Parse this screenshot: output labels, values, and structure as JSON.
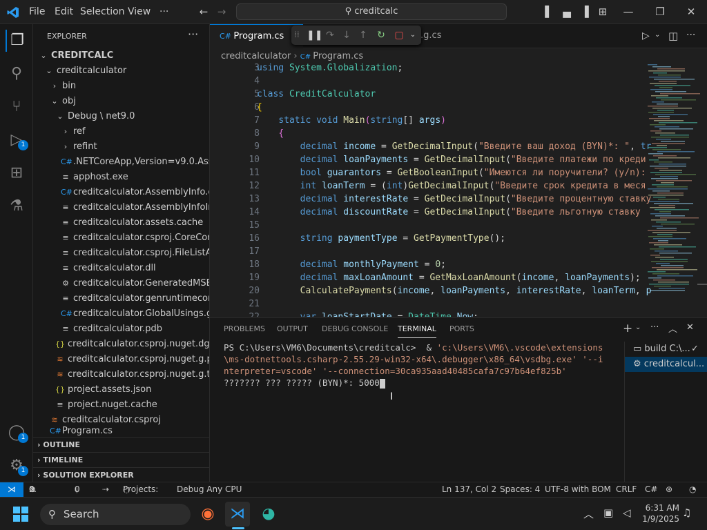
{
  "titlebar": {
    "menus": [
      "File",
      "Edit",
      "Selection",
      "View",
      "···"
    ],
    "search": "creditcalc"
  },
  "activity": {
    "badges": [
      "1",
      "1",
      "1"
    ]
  },
  "explorer": {
    "header": "EXPLORER",
    "more": "···",
    "tree": [
      {
        "label": "CREDITCALC",
        "icon": "chevron-down",
        "indent": 0,
        "bold": true
      },
      {
        "label": "creditcalculator",
        "icon": "chevron-down",
        "indent": 1
      },
      {
        "label": "bin",
        "icon": "chevron-right",
        "indent": 2
      },
      {
        "label": "obj",
        "icon": "chevron-down",
        "indent": 2
      },
      {
        "label": "Debug \\ net9.0",
        "icon": "chevron-down",
        "indent": 3
      },
      {
        "label": "ref",
        "icon": "chevron-right",
        "indent": 4
      },
      {
        "label": "refint",
        "icon": "chevron-right",
        "indent": 4
      },
      {
        "label": ".NETCoreApp,Version=v9.0.Asse...",
        "icon": "csharp",
        "indent": 4
      },
      {
        "label": "apphost.exe",
        "icon": "file",
        "indent": 4
      },
      {
        "label": "creditcalculator.AssemblyInfo.cs",
        "icon": "csharp",
        "indent": 4
      },
      {
        "label": "creditcalculator.AssemblyInfoInp...",
        "icon": "file",
        "indent": 4
      },
      {
        "label": "creditcalculator.assets.cache",
        "icon": "file",
        "indent": 4
      },
      {
        "label": "creditcalculator.csproj.CoreCom...",
        "icon": "file",
        "indent": 4
      },
      {
        "label": "creditcalculator.csproj.FileListAb...",
        "icon": "file",
        "indent": 4
      },
      {
        "label": "creditcalculator.dll",
        "icon": "file",
        "indent": 4
      },
      {
        "label": "creditcalculator.GeneratedMSBui...",
        "icon": "gear",
        "indent": 4
      },
      {
        "label": "creditcalculator.genruntimeconfi...",
        "icon": "file",
        "indent": 4
      },
      {
        "label": "creditcalculator.GlobalUsings.g.cs",
        "icon": "csharp",
        "indent": 4
      },
      {
        "label": "creditcalculator.pdb",
        "icon": "file",
        "indent": 4
      },
      {
        "label": "creditcalculator.csproj.nuget.dgsp...",
        "icon": "json",
        "indent": 3
      },
      {
        "label": "creditcalculator.csproj.nuget.g.pro...",
        "icon": "rss",
        "indent": 3
      },
      {
        "label": "creditcalculator.csproj.nuget.g.tar...",
        "icon": "rss",
        "indent": 3
      },
      {
        "label": "project.assets.json",
        "icon": "json",
        "indent": 3
      },
      {
        "label": "project.nuget.cache",
        "icon": "file",
        "indent": 3
      },
      {
        "label": "creditcalculator.csproj",
        "icon": "rss",
        "indent": 2
      },
      {
        "label": "Program.cs",
        "icon": "csharp",
        "indent": 2
      }
    ],
    "sections": [
      "OUTLINE",
      "TIMELINE",
      "SOLUTION EXPLORER"
    ]
  },
  "editor": {
    "tab_active": "Program.cs",
    "tab_other": "gs.g.cs",
    "breadcrumb": [
      "creditcalculator",
      "Program.cs"
    ],
    "lines": [
      {
        "n": "3",
        "html": "<span class='kw'>using</span> <span class='ty'>System.Globalization</span>;"
      },
      {
        "n": "4",
        "html": ""
      },
      {
        "n": "5",
        "html": "<span class='kw'>class</span> <span class='ty'>CreditCalculator</span>"
      },
      {
        "n": "6",
        "html": "<span class='br'>{</span>"
      },
      {
        "n": "7",
        "html": "    <span class='kw'>static</span> <span class='kw'>void</span> <span class='fn'>Main</span><span class='pu'>(</span><span class='kw'>string</span>[] <span class='vr'>args</span><span class='pu'>)</span>"
      },
      {
        "n": "8",
        "html": "    <span class='pu'>{</span>"
      },
      {
        "n": "9",
        "html": "        <span class='kw'>decimal</span> <span class='vr'>income</span> = <span class='fn'>GetDecimalInput</span>(<span class='st'>\"Введите ваш доход (BYN)*: \"</span>, <span class='kw'>tr</span>"
      },
      {
        "n": "10",
        "html": "        <span class='kw'>decimal</span> <span class='vr'>loanPayments</span> = <span class='fn'>GetDecimalInput</span>(<span class='st'>\"Введите платежи по креди</span>"
      },
      {
        "n": "11",
        "html": "        <span class='kw'>bool</span> <span class='vr'>guarantors</span> = <span class='fn'>GetBooleanInput</span>(<span class='st'>\"Имеются ли поручители? (y/n):</span>"
      },
      {
        "n": "12",
        "html": "        <span class='kw'>int</span> <span class='vr'>loanTerm</span> = (<span class='kw'>int</span>)<span class='fn'>GetDecimalInput</span>(<span class='st'>\"Введите срок кредита в меся</span>"
      },
      {
        "n": "13",
        "html": "        <span class='kw'>decimal</span> <span class='vr'>interestRate</span> = <span class='fn'>GetDecimalInput</span>(<span class='st'>\"Введите процентную ставку</span>"
      },
      {
        "n": "14",
        "html": "        <span class='kw'>decimal</span> <span class='vr'>discountRate</span> = <span class='fn'>GetDecimalInput</span>(<span class='st'>\"Введите льготную ставку</span>"
      },
      {
        "n": "15",
        "html": ""
      },
      {
        "n": "16",
        "html": "        <span class='kw'>string</span> <span class='vr'>paymentType</span> = <span class='fn'>GetPaymentType</span>();"
      },
      {
        "n": "17",
        "html": ""
      },
      {
        "n": "18",
        "html": "        <span class='kw'>decimal</span> <span class='vr'>monthlyPayment</span> = <span class='nm'>0</span>;"
      },
      {
        "n": "19",
        "html": "        <span class='kw'>decimal</span> <span class='vr'>maxLoanAmount</span> = <span class='fn'>GetMaxLoanAmount</span>(<span class='vr'>income</span>, <span class='vr'>loanPayments</span>);"
      },
      {
        "n": "20",
        "html": "        <span class='fn'>CalculatePayments</span>(<span class='vr'>income</span>, <span class='vr'>loanPayments</span>, <span class='vr'>interestRate</span>, <span class='vr'>loanTerm</span>, <span class='vr'>p</span>"
      },
      {
        "n": "21",
        "html": ""
      },
      {
        "n": "22",
        "html": "        <span class='kw'>var</span> <span class='vr'>loanStartDate</span> = <span class='ty'>DateTime</span>.<span class='vr'>Now</span>;"
      }
    ]
  },
  "panel": {
    "tabs": [
      "PROBLEMS",
      "OUTPUT",
      "DEBUG CONSOLE",
      "TERMINAL",
      "PORTS"
    ],
    "active_tab": "TERMINAL",
    "terminal_lines": [
      "PS C:\\Users\\VM6\\Documents\\creditcalc>  & 'c:\\Users\\VM6\\.vscode\\extensions",
      "\\ms-dotnettools.csharp-2.55.29-win32-x64\\.debugger\\x86_64\\vsdbg.exe' '--i",
      "nterpreter=vscode' '--connection=30ca935aad40485cafa7c97b64ef825b'",
      "??????? ??? ????? (BYN)*: 5000"
    ],
    "terminals": [
      "build C:\\...",
      "creditcalcul..."
    ]
  },
  "statusbar": {
    "errors": "0",
    "warnings": "0",
    "ports": "0",
    "projects": "Projects:",
    "debug": "Debug Any CPU",
    "position": "Ln 137, Col 2",
    "spaces": "Spaces: 4",
    "encoding": "UTF-8 with BOM",
    "eol": "CRLF",
    "language": "C#"
  },
  "taskbar": {
    "search": "Search",
    "time": "6:31 AM",
    "date": "1/9/2025"
  }
}
